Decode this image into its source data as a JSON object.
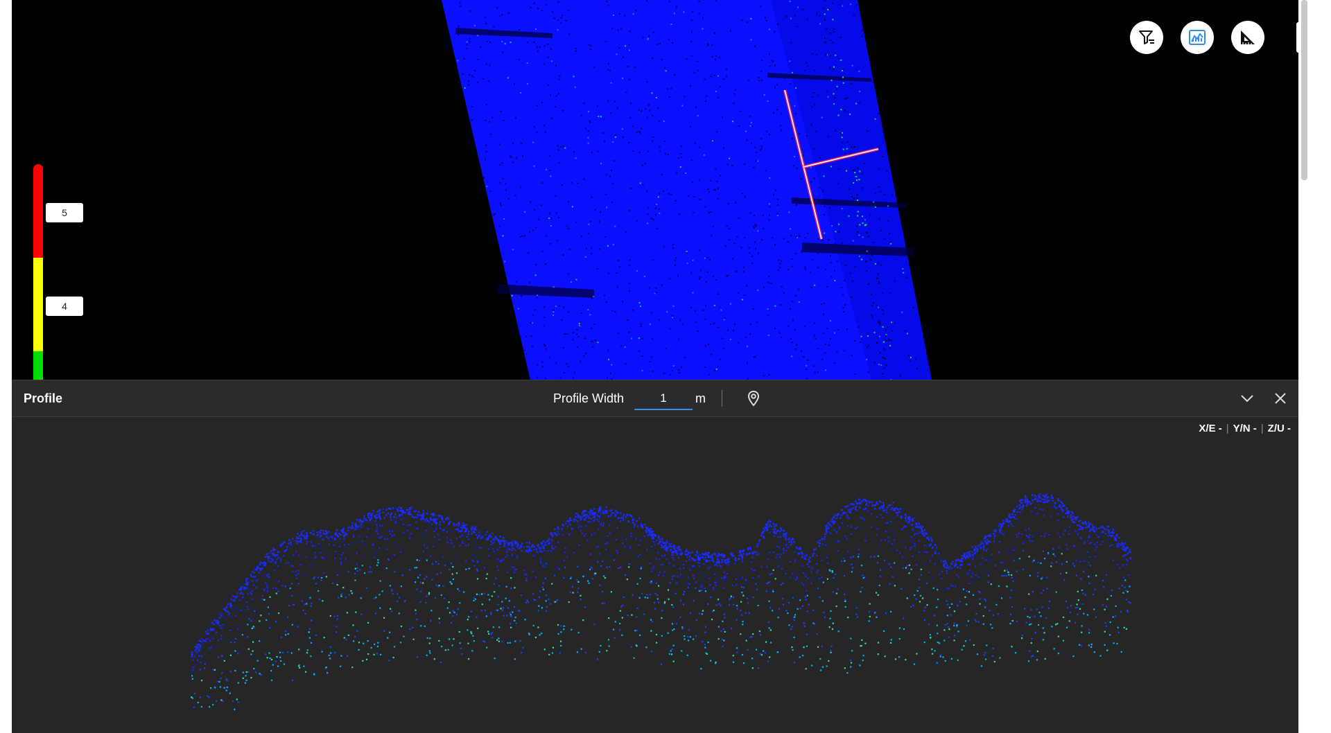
{
  "viewer": {
    "colors": {
      "background": "#000000",
      "cloud_base": "#0a10ff",
      "cloud_highlight": "#00c8a0",
      "profile_line": "#ffdddd",
      "profile_line_glow": "#ff2040"
    },
    "elevation_scale": {
      "labels": [
        "5",
        "4"
      ],
      "colors": [
        "#ff0000",
        "#ffff00",
        "#00dd00"
      ]
    },
    "toolbar": {
      "buttons": [
        {
          "name": "filter-button",
          "icon": "filter-icon"
        },
        {
          "name": "profile-button",
          "icon": "profile-chart-icon",
          "active_color": "#2f8ce9"
        },
        {
          "name": "measure-button",
          "icon": "ruler-triangle-icon"
        }
      ],
      "expand_label": "»"
    }
  },
  "profile": {
    "title": "Profile",
    "width_label": "Profile Width",
    "width_value": "1",
    "width_unit": "m",
    "icons": {
      "pin": "location-pin-icon",
      "collapse": "chevron-down-icon",
      "close": "close-icon"
    },
    "coords": {
      "x": "X/E -",
      "y": "Y/N -",
      "z": "Z/U -"
    },
    "colors": {
      "background": "#262626",
      "header": "#2b2b2b",
      "points_base": "#1a2cff",
      "points_mid": "#00b4ff",
      "points_high": "#30e0a0"
    }
  }
}
